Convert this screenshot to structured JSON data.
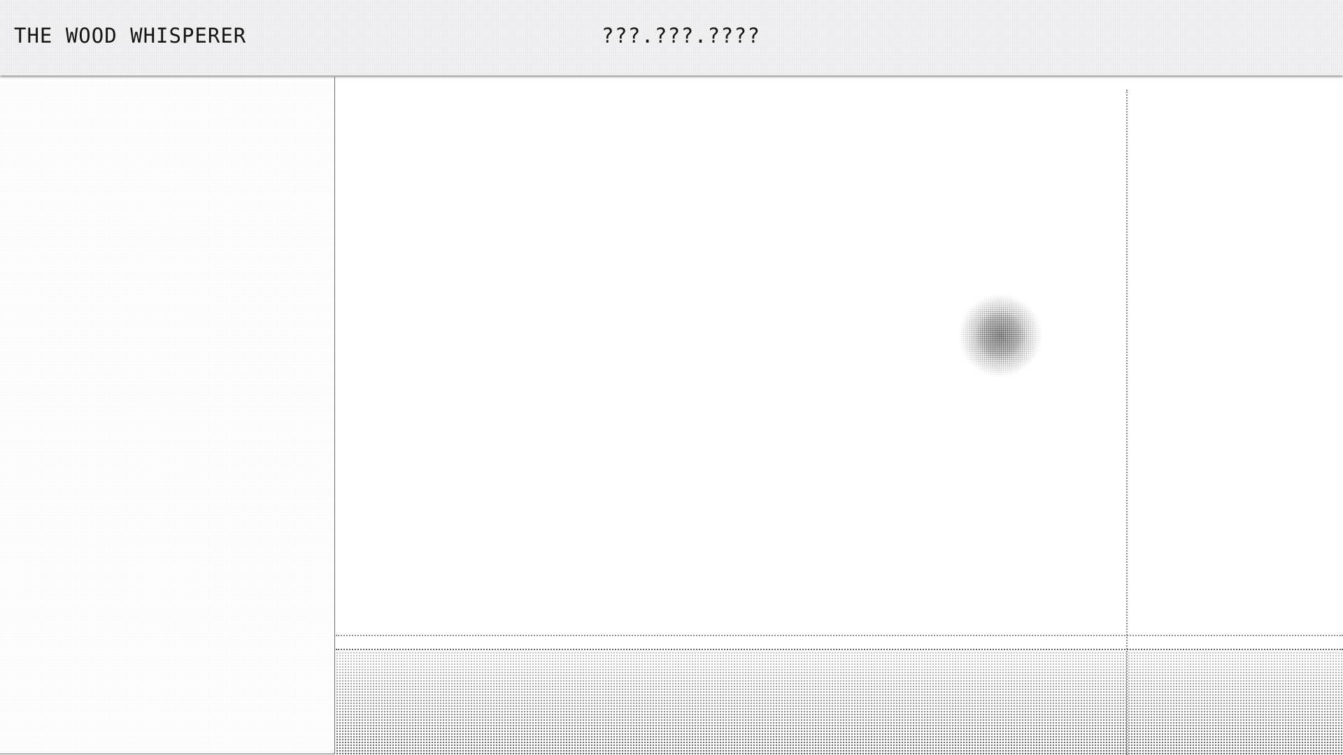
{
  "header": {
    "brand": "THE WOOD WHISPERER",
    "phone": "???.???.????"
  },
  "colors": {
    "header_bg": "#f1f1f2",
    "text": "#151515",
    "panel_border": "#6e6e6e",
    "scene_bg": "#ffffff"
  }
}
